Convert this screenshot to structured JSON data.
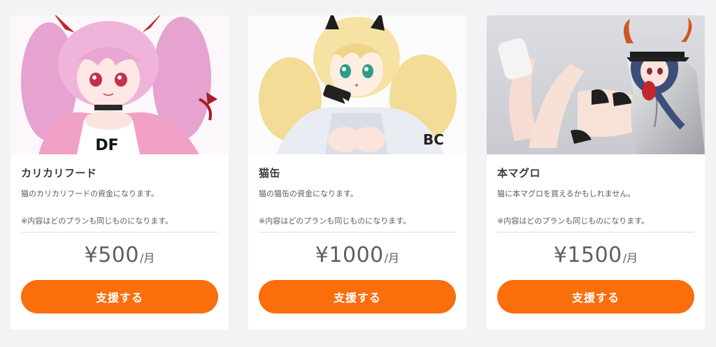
{
  "colors": {
    "page_background": "#f3f3f6",
    "card_background": "#ffffff",
    "accent_button": "#fb6e0c",
    "price_text": "#5f5f5f"
  },
  "plans": [
    {
      "image_name": "illustration-pink-twintail-girl",
      "title": "カリカリフード",
      "description": "猫のカリカリフードの資金になります。",
      "note": "※内容はどのプランも同じものになります。",
      "price": "¥500",
      "price_unit": "/月",
      "button_label": "支援する"
    },
    {
      "image_name": "illustration-blonde-twintail-girl",
      "title": "猫缶",
      "description": "猫の猫缶の資金になります。",
      "note": "※内容はどのプランも同じものになります。",
      "price": "¥1000",
      "price_unit": "/月",
      "button_label": "支援する"
    },
    {
      "image_name": "illustration-silver-jacket-girl",
      "title": "本マグロ",
      "description": "猫に本マグロを買えるかもしれません。",
      "note": "※内容はどのプランも同じものになります。",
      "price": "¥1500",
      "price_unit": "/月",
      "button_label": "支援する"
    }
  ]
}
